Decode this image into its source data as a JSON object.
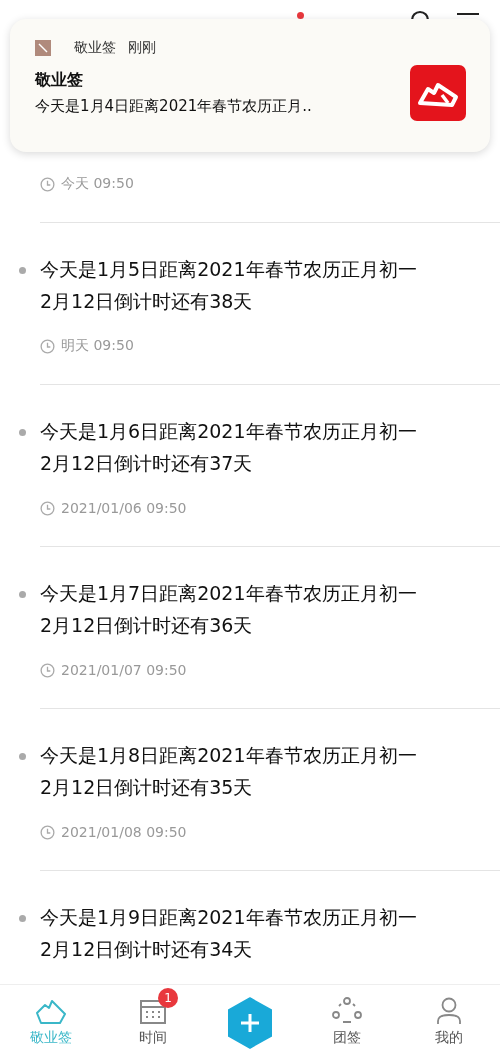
{
  "header": {
    "unread": true
  },
  "notification": {
    "app": "敬业签",
    "time": "刚刚",
    "title": "敬业签",
    "body": "今天是1月4日距离2021年春节农历正月.."
  },
  "notes": [
    {
      "time": "今天 09:50"
    },
    {
      "lines": [
        "今天是1月5日距离2021年春节农历正月初一",
        "2月12日倒计时还有38天"
      ],
      "time": "明天 09:50"
    },
    {
      "lines": [
        "今天是1月6日距离2021年春节农历正月初一",
        "2月12日倒计时还有37天"
      ],
      "time": "2021/01/06 09:50"
    },
    {
      "lines": [
        "今天是1月7日距离2021年春节农历正月初一",
        "2月12日倒计时还有36天"
      ],
      "time": "2021/01/07 09:50"
    },
    {
      "lines": [
        "今天是1月8日距离2021年春节农历正月初一",
        "2月12日倒计时还有35天"
      ],
      "time": "2021/01/08 09:50"
    },
    {
      "lines": [
        "今天是1月9日距离2021年春节农历正月初一",
        "2月12日倒计时还有34天"
      ]
    }
  ],
  "tabs": [
    {
      "kind": "notes",
      "label": "敬业签",
      "selected": true
    },
    {
      "kind": "calendar",
      "label": "时间",
      "selected": false,
      "badge": "1"
    },
    {
      "kind": "add"
    },
    {
      "kind": "team",
      "label": "团签",
      "selected": false
    },
    {
      "kind": "profile",
      "label": "我的",
      "selected": false
    }
  ]
}
